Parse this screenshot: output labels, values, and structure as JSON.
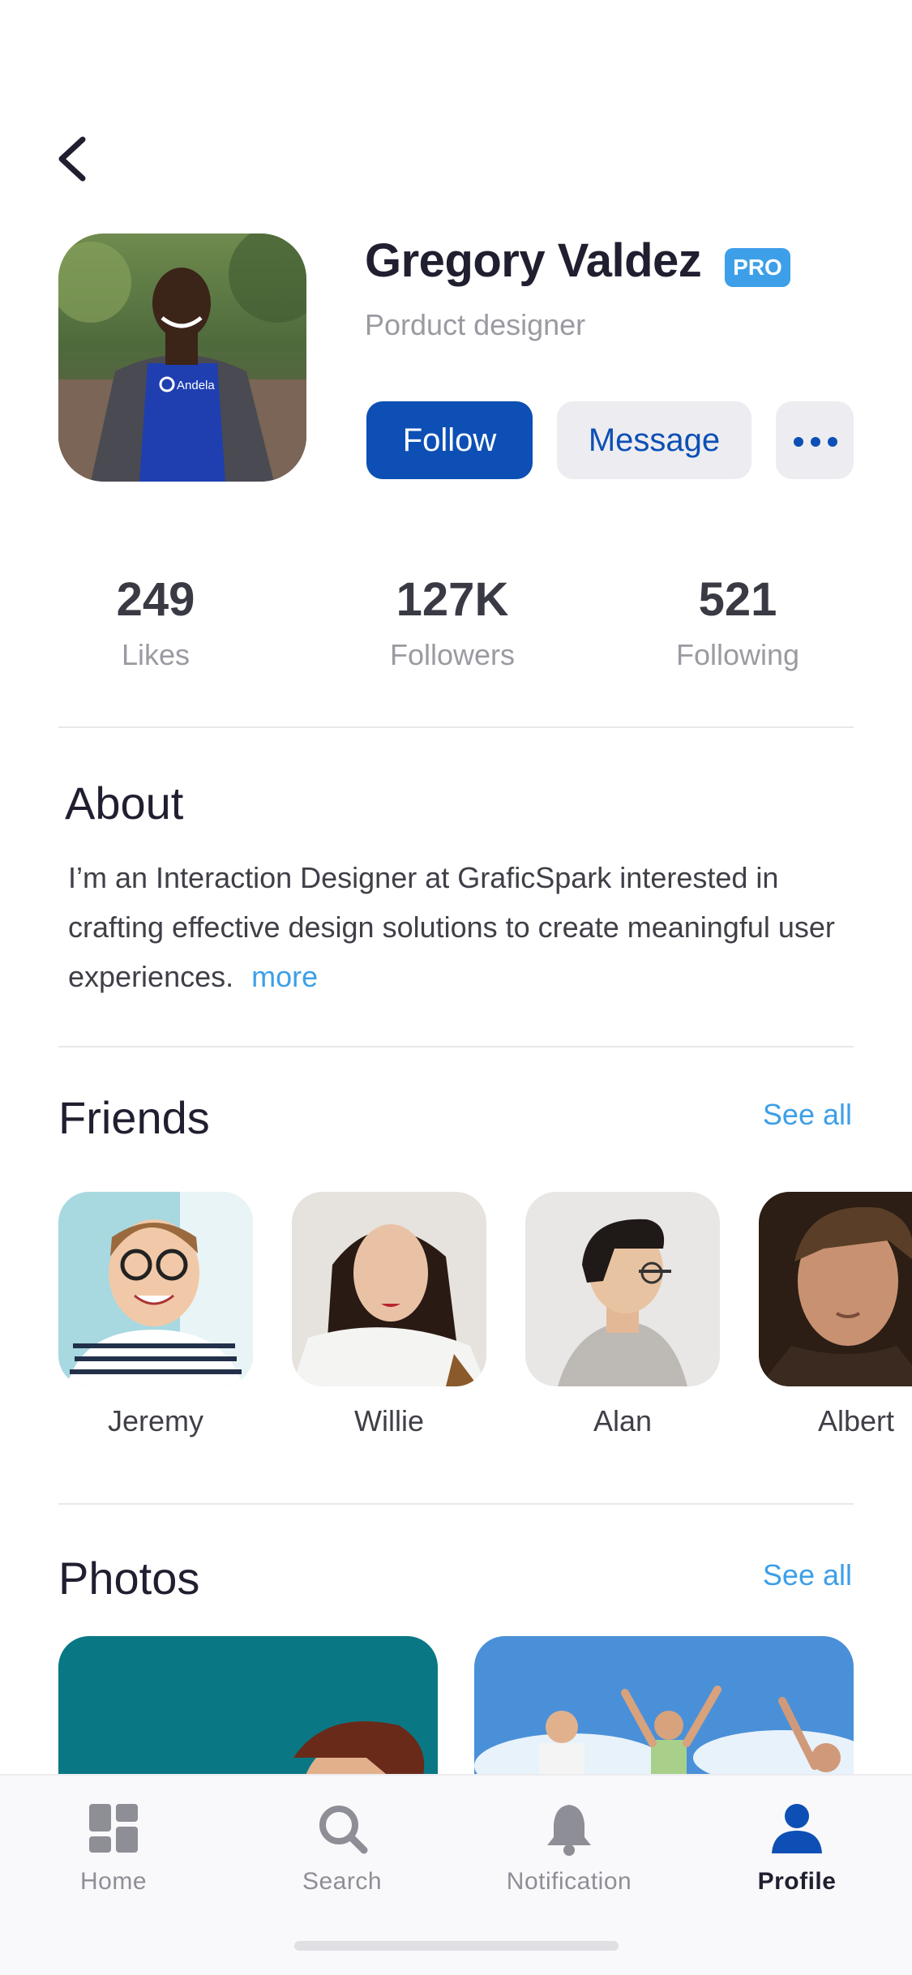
{
  "header": {
    "back_icon": "chevron-left-icon"
  },
  "profile": {
    "name": "Gregory Valdez",
    "badge": "PRO",
    "role": "Porduct designer",
    "shirt_text": "Andela",
    "follow_label": "Follow",
    "message_label": "Message",
    "more_icon": "more-dots-icon"
  },
  "stats": [
    {
      "value": "249",
      "label": "Likes"
    },
    {
      "value": "127K",
      "label": "Followers"
    },
    {
      "value": "521",
      "label": "Following"
    }
  ],
  "about": {
    "title": "About",
    "text": "I’m an Interaction Designer at GraficSpark interested in crafting effective design solutions to create meaningful user experiences.",
    "more_label": "more"
  },
  "friends": {
    "title": "Friends",
    "see_all": "See all",
    "items": [
      {
        "name": "Jeremy"
      },
      {
        "name": "Willie"
      },
      {
        "name": "Alan"
      },
      {
        "name": "Albert"
      }
    ]
  },
  "photos": {
    "title": "Photos",
    "see_all": "See all"
  },
  "tabbar": {
    "items": [
      {
        "label": "Home",
        "icon": "grid-home-icon"
      },
      {
        "label": "Search",
        "icon": "search-icon"
      },
      {
        "label": "Notification",
        "icon": "bell-icon"
      },
      {
        "label": "Profile",
        "icon": "person-icon",
        "active": true
      }
    ]
  },
  "colors": {
    "primary": "#0d4fb5",
    "accent": "#3d9fe8",
    "muted": "#9a9aa2"
  }
}
